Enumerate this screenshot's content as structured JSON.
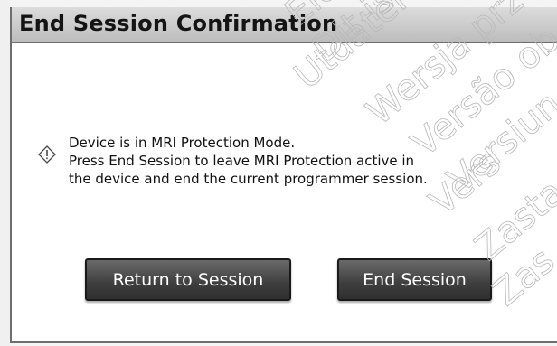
{
  "dialog": {
    "title": "End Session Confirmation",
    "message_lines": [
      "Device is in MRI Protection Mode.",
      "Press End Session to leave MRI Protection active in",
      "the device and end the current programmer session."
    ],
    "icon": "warning-diamond-icon",
    "buttons": {
      "return_label": "Return to Session",
      "end_label": "End Session"
    },
    "button_color": "#3e3e3e",
    "title_bar_color": "#c8c8c8"
  },
  "watermark": [
    "Ele",
    "Dit is",
    "Utdatert",
    "Wersja prze",
    "Versão ob",
    "Versiun",
    "Vers",
    "Zasta",
    "Zas"
  ]
}
